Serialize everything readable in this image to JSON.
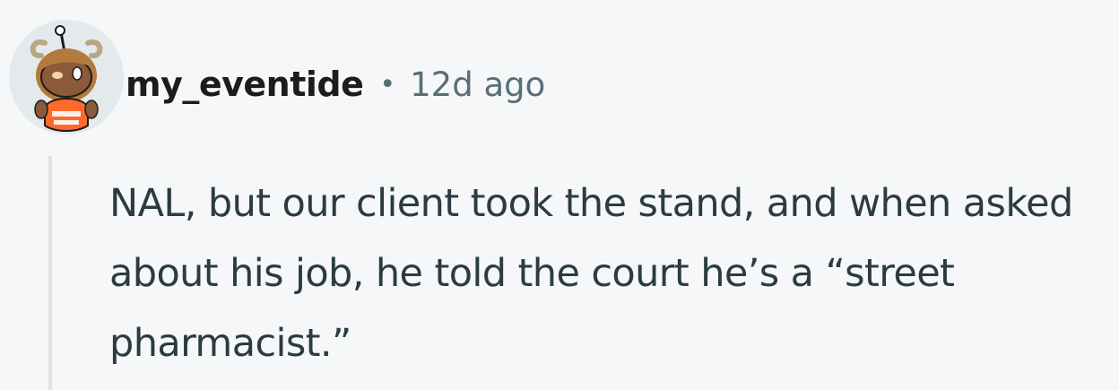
{
  "comment": {
    "username": "my_eventide",
    "separator": "•",
    "timestamp": "12d ago",
    "body": "NAL, but our client took the stand, and when asked about his job, he told the court he’s a “street pharmacist.”",
    "avatar_icon": "snoo-avatar-icon"
  },
  "colors": {
    "background": "#f6f7f8",
    "username": "#1c1c1c",
    "meta": "#576f76",
    "body_text": "#2a3c42",
    "thread_line": "#dde3e6"
  }
}
